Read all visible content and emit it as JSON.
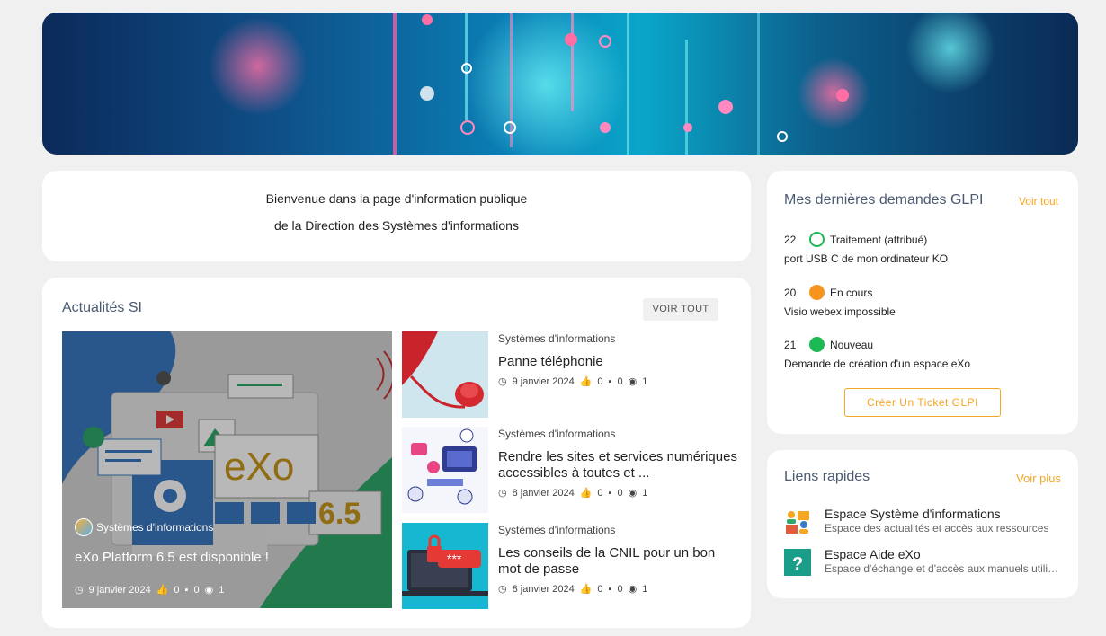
{
  "welcome": {
    "line1": "Bienvenue dans la page d'information publique",
    "line2": "de la Direction des Systèmes d'informations"
  },
  "news": {
    "title": "Actualités SI",
    "voir_tout": "VOIR TOUT",
    "featured": {
      "category": "Systèmes d'informations",
      "title": "eXo Platform 6.5 est disponible !",
      "image_text_brand": "eXo",
      "image_text_version": "6.5",
      "date": "9 janvier 2024",
      "likes": "0",
      "comments": "0",
      "views": "1"
    },
    "items": [
      {
        "category": "Systèmes d'informations",
        "title": "Panne téléphonie",
        "date": "9 janvier 2024",
        "likes": "0",
        "comments": "0",
        "views": "1"
      },
      {
        "category": "Systèmes d'informations",
        "title": "Rendre les sites et services numériques accessibles à toutes et ...",
        "date": "8 janvier 2024",
        "likes": "0",
        "comments": "0",
        "views": "1"
      },
      {
        "category": "Systèmes d'informations",
        "title": "Les conseils de la CNIL pour un bon mot de passe",
        "date": "8 janvier 2024",
        "likes": "0",
        "comments": "0",
        "views": "1"
      }
    ]
  },
  "glpi": {
    "title": "Mes dernières demandes GLPI",
    "voir_tout": "Voir tout",
    "requests": [
      {
        "id": "22",
        "status": "Traitement (attribué)",
        "status_color": "#1db954",
        "status_style": "outline",
        "subject": "port USB C de mon ordinateur KO"
      },
      {
        "id": "20",
        "status": "En cours",
        "status_color": "#f7941d",
        "status_style": "filled",
        "subject": "Visio webex impossible"
      },
      {
        "id": "21",
        "status": "Nouveau",
        "status_color": "#1db954",
        "status_style": "filled",
        "subject": "Demande de création d'un espace eXo"
      }
    ],
    "create_button": "Créer Un Ticket GLPI"
  },
  "links": {
    "title": "Liens rapides",
    "voir_plus": "Voir plus",
    "items": [
      {
        "title": "Espace Système d'informations",
        "desc": "Espace des actualités et accès aux ressources",
        "icon": "people-icon"
      },
      {
        "title": "Espace Aide eXo",
        "desc": "Espace d'échange et d'accès aux manuels utilisateurs",
        "icon": "help-icon"
      }
    ]
  },
  "colors": {
    "accent": "#f5a623",
    "heading": "#4a5a72"
  }
}
